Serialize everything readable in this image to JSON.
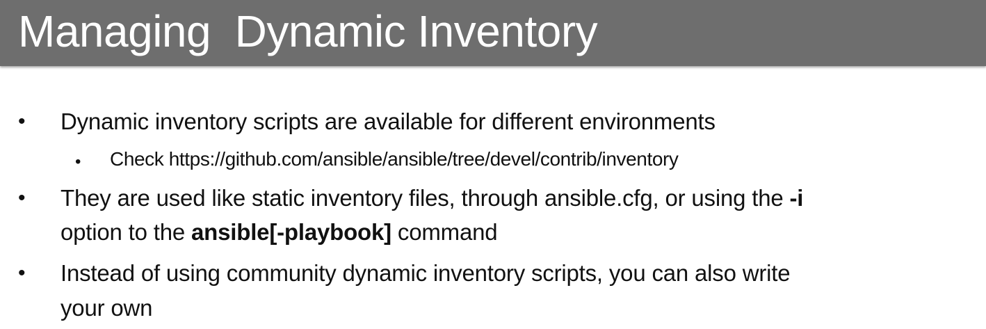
{
  "slide": {
    "title": "Managing  Dynamic Inventory",
    "bullets": [
      {
        "marker": "•",
        "text": "Dynamic inventory scripts are available for different environments",
        "sub": {
          "marker": "•",
          "text": "Check https://github.com/ansible/ansible/tree/devel/contrib/inventory"
        }
      },
      {
        "marker": "•",
        "line1_a": "They are used like static inventory files, through ansible.cfg, or using the ",
        "line1_bold": "-i",
        "line2_a": "option to the ",
        "line2_bold": "ansible[-playbook]",
        "line2_b": " command"
      },
      {
        "marker": "•",
        "line1": "Instead of using community dynamic inventory scripts, you can also write",
        "line2": "your own"
      }
    ]
  },
  "colors": {
    "title_bar": "#6e6e6e",
    "title_text": "#ffffff",
    "body_text": "#111111",
    "background": "#ffffff"
  }
}
